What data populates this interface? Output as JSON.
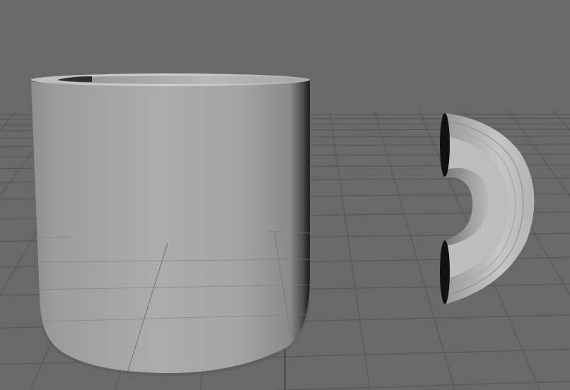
{
  "viewport": {
    "background": "#696969",
    "grid_color": "#555555",
    "grid_axis_color": "#2e2e2e"
  },
  "scene": {
    "objects": [
      {
        "name": "mug-body",
        "shape": "cylinder",
        "shading": "gray"
      },
      {
        "name": "mug-handle",
        "shape": "half-torus",
        "shading": "gray"
      }
    ]
  }
}
